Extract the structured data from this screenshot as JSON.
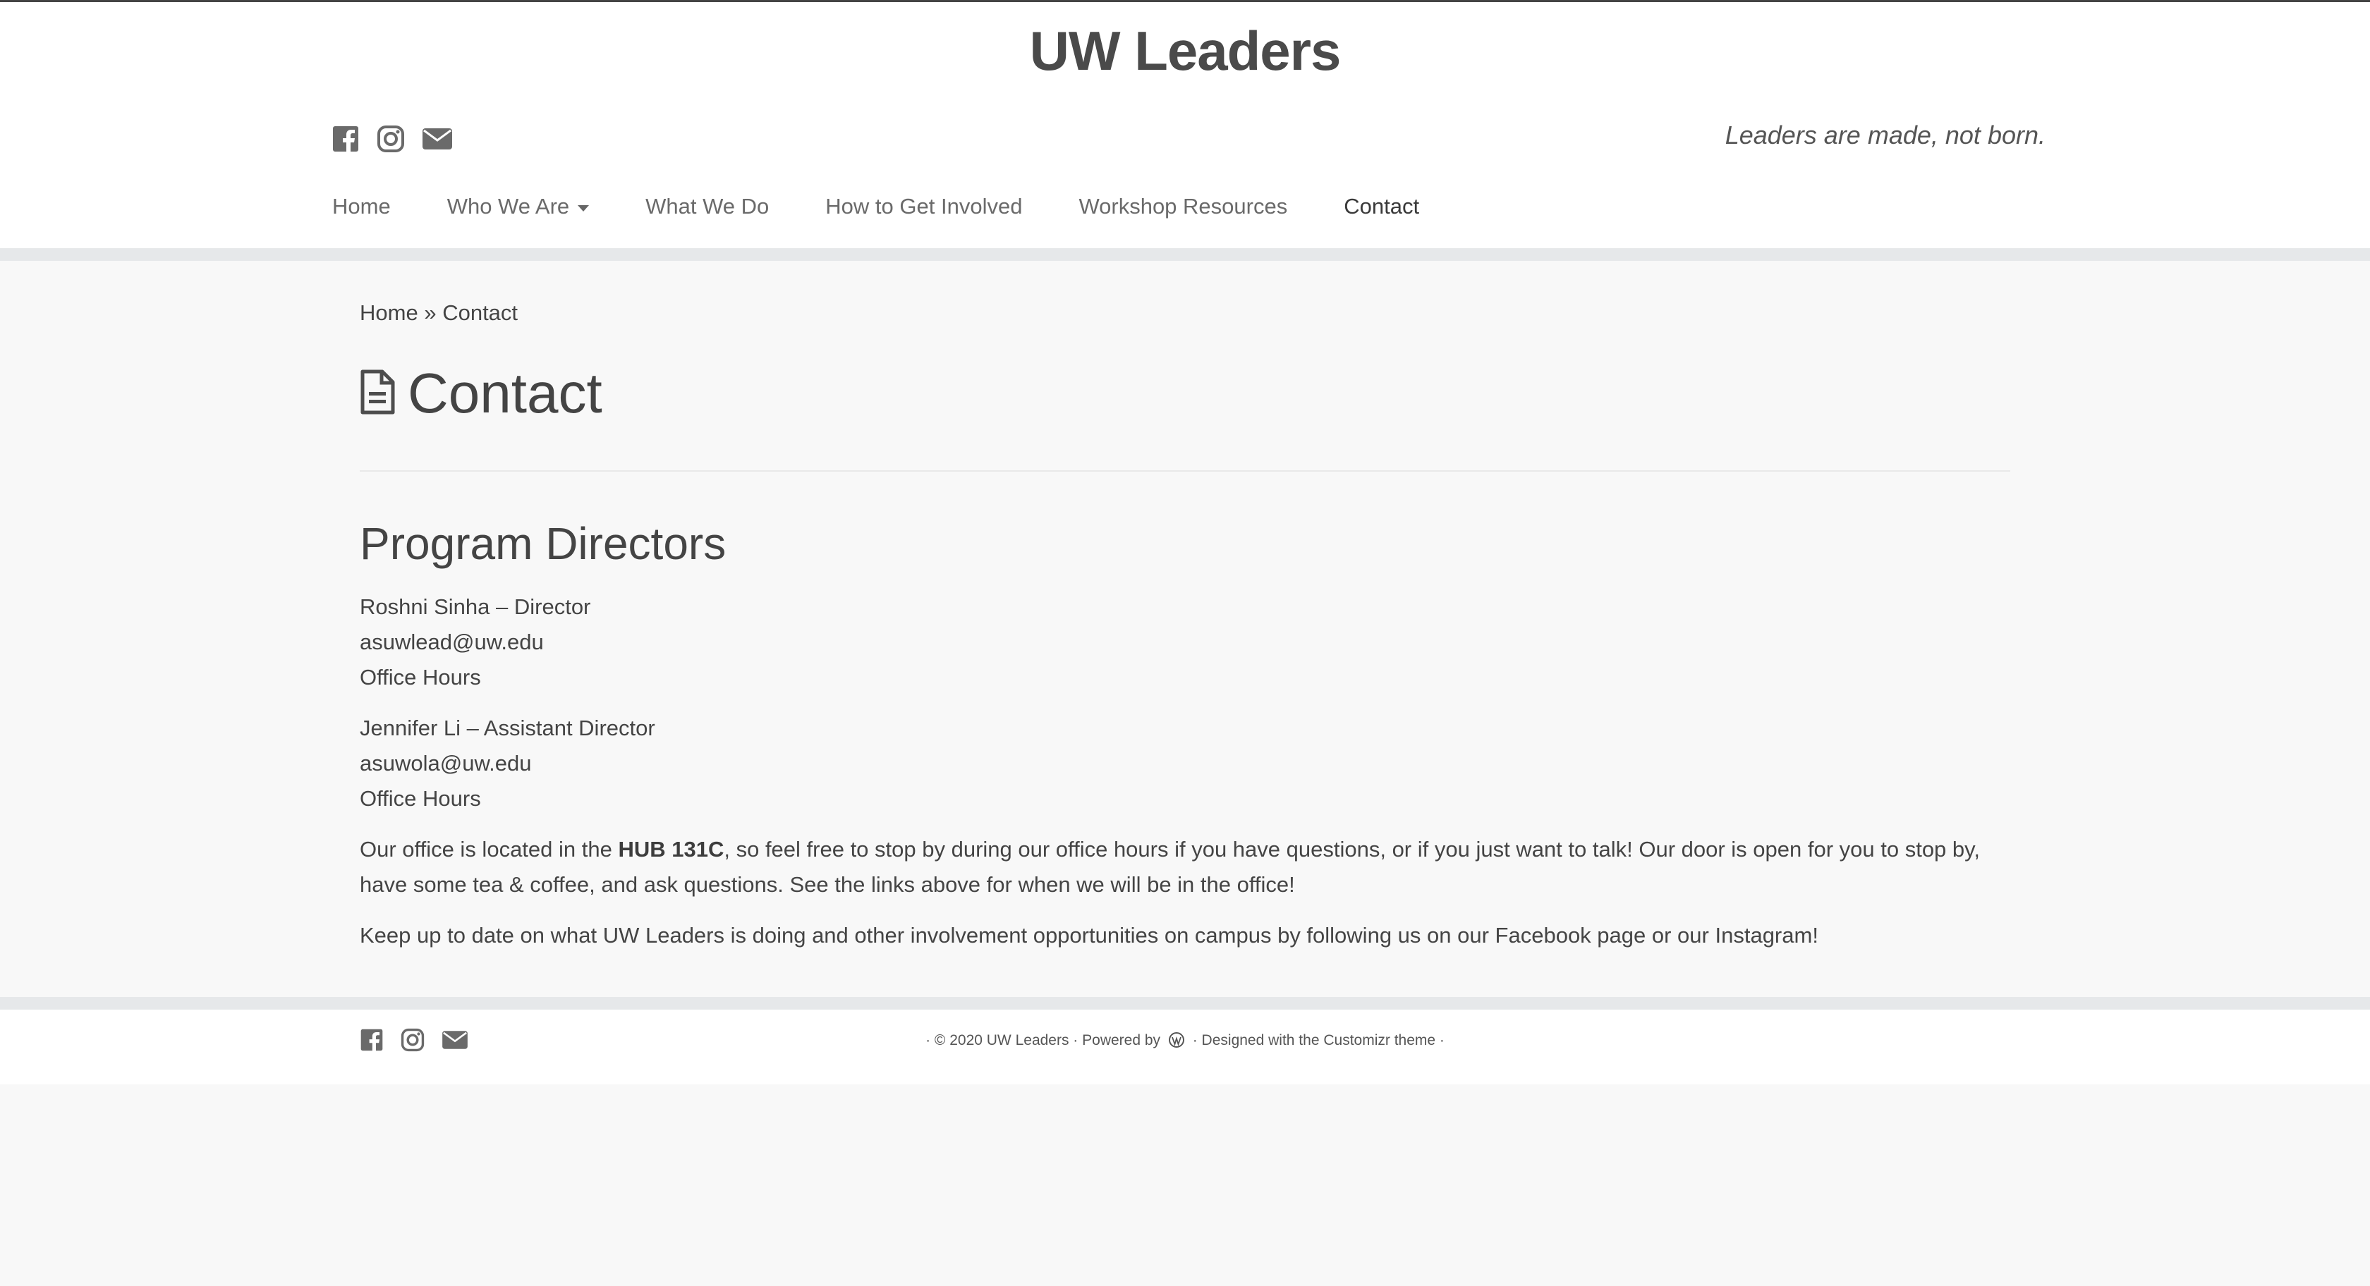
{
  "site": {
    "title": "UW Leaders",
    "tagline": "Leaders are made, not born."
  },
  "social": [
    {
      "icon": "facebook-icon"
    },
    {
      "icon": "instagram-icon"
    },
    {
      "icon": "email-icon"
    }
  ],
  "nav": {
    "items": [
      {
        "label": "Home"
      },
      {
        "label": "Who We Are"
      },
      {
        "label": "What We Do"
      },
      {
        "label": "How to Get Involved"
      },
      {
        "label": "Workshop Resources"
      },
      {
        "label": "Contact"
      }
    ]
  },
  "breadcrumb": {
    "home": "Home",
    "separator": "»",
    "current": "Contact"
  },
  "page": {
    "title": "Contact",
    "section_heading": "Program Directors",
    "director1": {
      "name_role": "Roshni Sinha – Director",
      "email": "asuwlead@uw.edu",
      "hours": "Office Hours"
    },
    "director2": {
      "name_role": "Jennifer Li – Assistant Director",
      "email": "asuwola@uw.edu",
      "hours": "Office Hours"
    },
    "office": {
      "before": "Our office is located in the ",
      "location": "HUB 131C",
      "after": ", so feel free to stop by during our office hours if you have questions, or if you just want to talk! Our door is open for you to stop by, have some tea & coffee, and ask questions. See the links above for when we will be in the office!"
    },
    "followup": {
      "before": "Keep up to date on what UW Leaders is doing and other involvement opportunities on campus by following us on our ",
      "facebook_link": "Facebook page",
      "middle": " or our ",
      "instagram_link": "Instagram",
      "after": "!"
    }
  },
  "footer": {
    "copyright": "· © 2020 UW Leaders · Powered by",
    "designed": "· Designed with the",
    "theme_link": "Customizr theme",
    "end": "·"
  },
  "colors": {
    "band": "#e6e8ea",
    "text": "#444444",
    "background": "#f8f8f8"
  }
}
